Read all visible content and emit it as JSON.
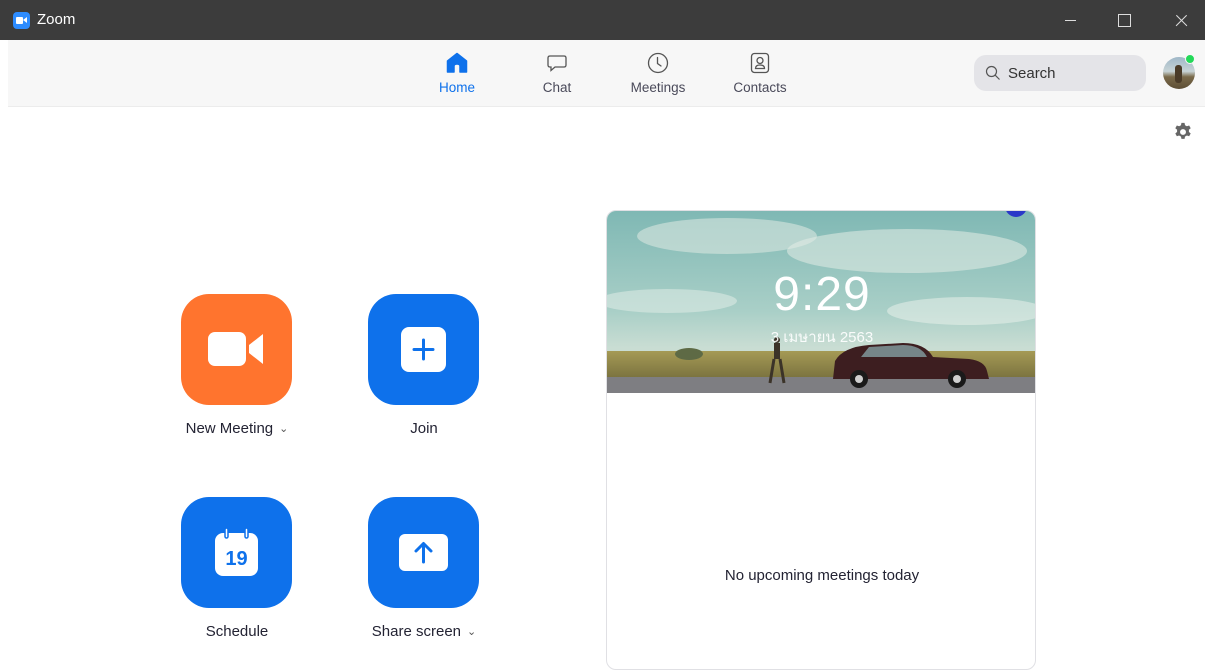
{
  "window": {
    "title": "Zoom",
    "controls": [
      "minimize",
      "maximize",
      "close"
    ]
  },
  "nav": {
    "tabs": [
      {
        "label": "Home",
        "icon": "home-icon",
        "active": true
      },
      {
        "label": "Chat",
        "icon": "chat-icon",
        "active": false
      },
      {
        "label": "Meetings",
        "icon": "clock-icon",
        "active": false
      },
      {
        "label": "Contacts",
        "icon": "contacts-icon",
        "active": false
      }
    ],
    "search": {
      "placeholder": "Search",
      "value": ""
    },
    "presence": "available"
  },
  "actions": {
    "new_meeting": {
      "label": "New Meeting",
      "icon": "video-camera-icon",
      "color": "#ff742e",
      "has_dropdown": true
    },
    "join": {
      "label": "Join",
      "icon": "plus-icon",
      "color": "#0e71eb"
    },
    "schedule": {
      "label": "Schedule",
      "icon": "calendar-icon",
      "calendar_day": "19",
      "color": "#0e71eb"
    },
    "share_screen": {
      "label": "Share screen",
      "icon": "share-up-arrow-icon",
      "color": "#0e71eb",
      "has_dropdown": true
    }
  },
  "meeting_card": {
    "time": "9:29",
    "date": "3 เมษายน 2563",
    "empty_message": "No upcoming meetings today"
  },
  "colors": {
    "accent": "#0e71eb",
    "orange": "#ff742e",
    "titlebar": "#3c3c3c",
    "online": "#23d959"
  }
}
